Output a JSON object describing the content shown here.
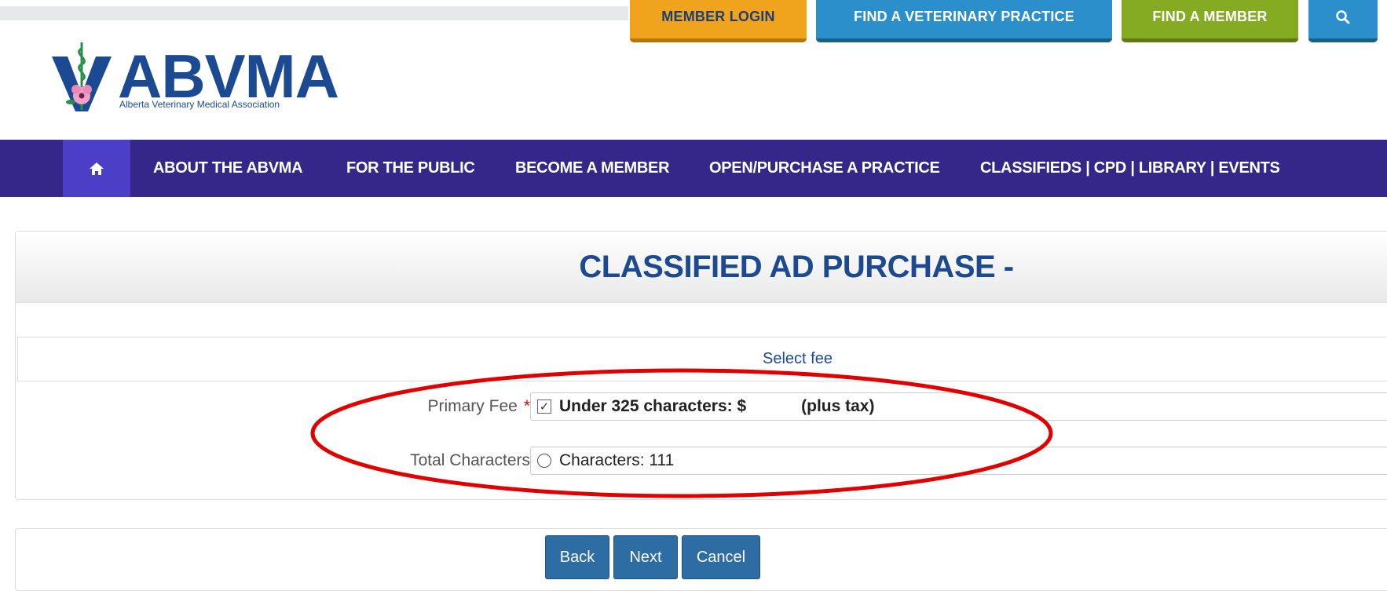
{
  "header": {
    "top_buttons": {
      "member_login": "MEMBER LOGIN",
      "find_practice": "FIND A VETERINARY PRACTICE",
      "find_member": "FIND A MEMBER"
    },
    "search_icon": "search-icon",
    "logo": {
      "name": "ABVMA",
      "subtitle": "Alberta Veterinary Medical Association"
    }
  },
  "nav": {
    "home_icon": "home-icon",
    "items": [
      "ABOUT THE ABVMA",
      "FOR THE PUBLIC",
      "BECOME A MEMBER",
      "OPEN/PURCHASE A PRACTICE",
      "CLASSIFIEDS | CPD | LIBRARY | EVENTS"
    ]
  },
  "form": {
    "title": "CLASSIFIED AD PURCHASE -",
    "section_title": "Select fee",
    "primary_fee": {
      "label": "Primary Fee",
      "required_mark": "*",
      "option_text": "Under 325 characters: $",
      "tax_text": "(plus tax)",
      "checked": true
    },
    "total_characters": {
      "label": "Total Characters",
      "option_text": "Characters: 111",
      "selected": false
    }
  },
  "actions": {
    "back": "Back",
    "next": "Next",
    "cancel": "Cancel"
  },
  "colors": {
    "nav_bg": "#35278a",
    "login_btn": "#f0a41d",
    "practice_btn": "#2a8fca",
    "member_btn": "#85ab22",
    "title_blue": "#1b4a92",
    "annotation_red": "#e00000"
  }
}
